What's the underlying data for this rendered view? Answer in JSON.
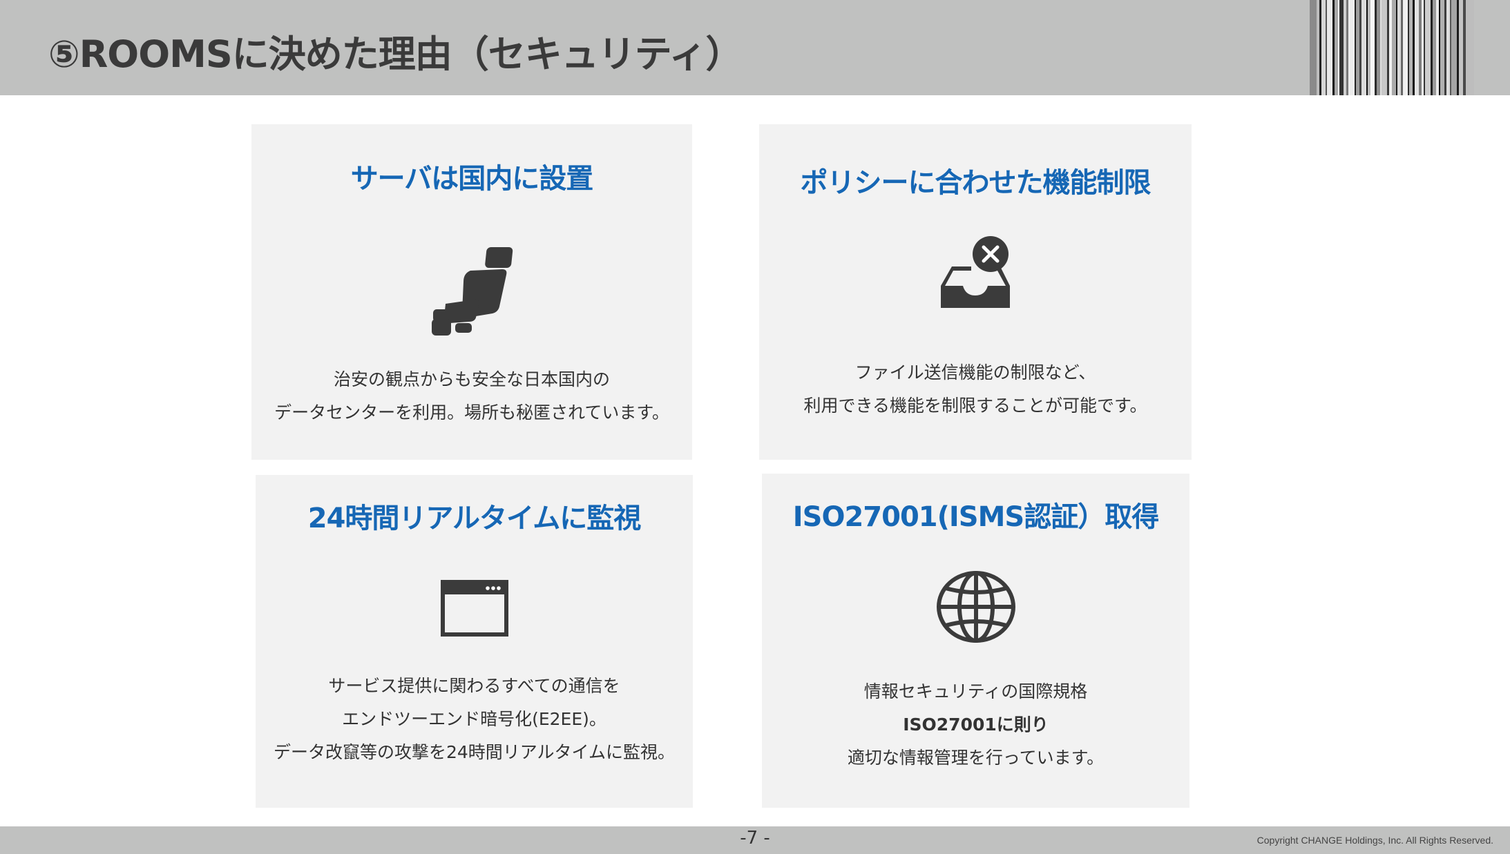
{
  "header": {
    "title": "⑤ROOMSに決めた理由（セキュリティ）"
  },
  "cards": [
    {
      "title": "サーバは国内に設置",
      "icon": "japan-map-icon",
      "lines": [
        "治安の観点からも安全な日本国内の",
        "データセンターを利用。場所も秘匿されています。"
      ]
    },
    {
      "title": "ポリシーに合わせた機能制限",
      "icon": "inbox-blocked-icon",
      "lines": [
        "ファイル送信機能の制限など、",
        "利用できる機能を制限することが可能です。"
      ]
    },
    {
      "title": "24時間リアルタイムに監視",
      "icon": "browser-window-icon",
      "lines": [
        "サービス提供に関わるすべての通信を",
        "エンドツーエンド暗号化(E2EE)。",
        "データ改竄等の攻撃を24時間リアルタイムに監視。"
      ]
    },
    {
      "title": "ISO27001(ISMS認証）取得",
      "icon": "globe-icon",
      "lines": [
        "情報セキュリティの国際規格",
        "ISO27001に則り",
        "適切な情報管理を行っています。"
      ]
    }
  ],
  "footer": {
    "page_number": "-7 -",
    "copyright": "Copyright CHANGE Holdings, Inc. All Rights Reserved."
  },
  "colors": {
    "header_bg": "#c0c1c0",
    "card_bg": "#f2f2f2",
    "title_blue": "#1667b5",
    "icon_dark": "#3b3b3b"
  }
}
